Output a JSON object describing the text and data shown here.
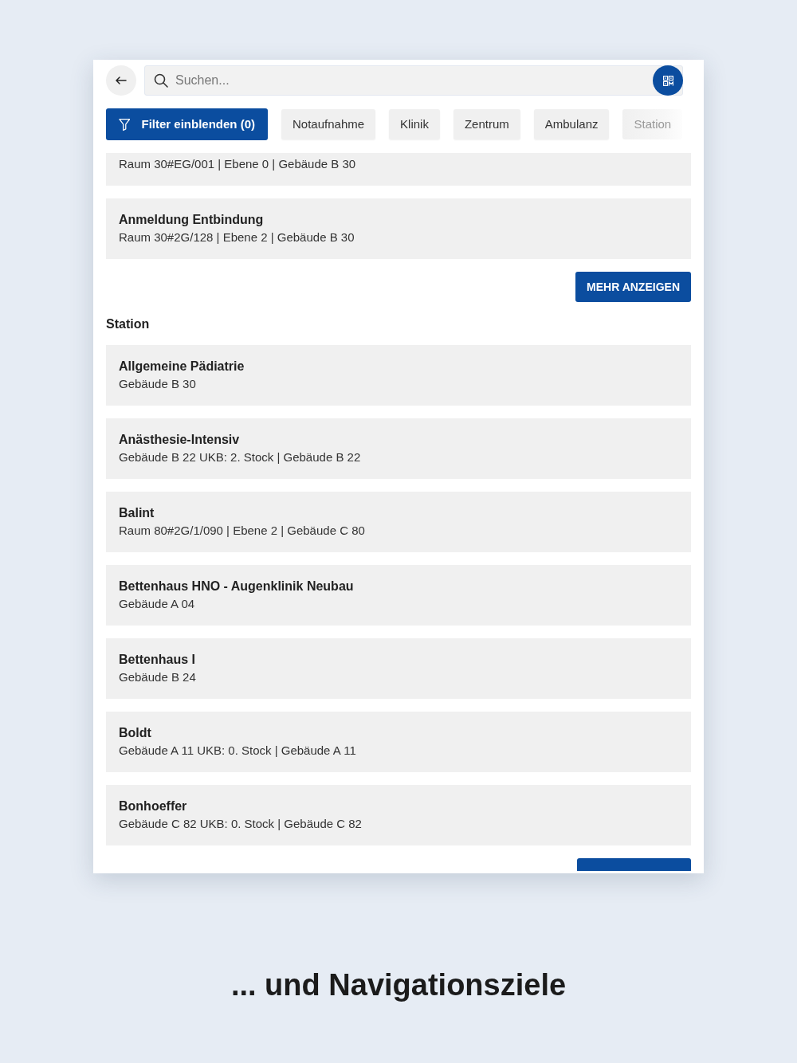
{
  "search": {
    "placeholder": "Suchen..."
  },
  "filter_button": {
    "label": "Filter einblenden (0)"
  },
  "chips": [
    {
      "label": "Notaufnahme",
      "faded": false
    },
    {
      "label": "Klinik",
      "faded": false
    },
    {
      "label": "Zentrum",
      "faded": false
    },
    {
      "label": "Ambulanz",
      "faded": false
    },
    {
      "label": "Station",
      "faded": true
    }
  ],
  "sections": [
    {
      "items": [
        {
          "subtitle": "Raum 30#EG/001 | Ebene 0 | Gebäude B 30",
          "cut_off": true
        },
        {
          "title": "Anmeldung Entbindung",
          "subtitle": "Raum 30#2G/128 | Ebene 2 | Gebäude B 30",
          "cut_off": false
        }
      ],
      "more_button": {
        "label": "MEHR ANZEIGEN",
        "cut_off": false
      }
    },
    {
      "heading": "Station",
      "items": [
        {
          "title": "Allgemeine Pädiatrie",
          "subtitle": "Gebäude B 30",
          "cut_off": false
        },
        {
          "title": "Anästhesie-Intensiv",
          "subtitle": "Gebäude B 22 UKB: 2. Stock | Gebäude B 22",
          "cut_off": false
        },
        {
          "title": "Balint",
          "subtitle": "Raum 80#2G/1/090 | Ebene 2 | Gebäude C 80",
          "cut_off": false
        },
        {
          "title": "Bettenhaus HNO - Augenklinik Neubau",
          "subtitle": "Gebäude A 04",
          "cut_off": false
        },
        {
          "title": "Bettenhaus I",
          "subtitle": "Gebäude B 24",
          "cut_off": false
        },
        {
          "title": "Boldt",
          "subtitle": "Gebäude A 11 UKB: 0. Stock | Gebäude A 11",
          "cut_off": false
        },
        {
          "title": "Bonhoeffer",
          "subtitle": "Gebäude C 82 UKB: 0. Stock | Gebäude C 82",
          "cut_off": false
        }
      ],
      "more_button": {
        "cut_off": true
      }
    }
  ],
  "caption": "... und Navigationsziele"
}
